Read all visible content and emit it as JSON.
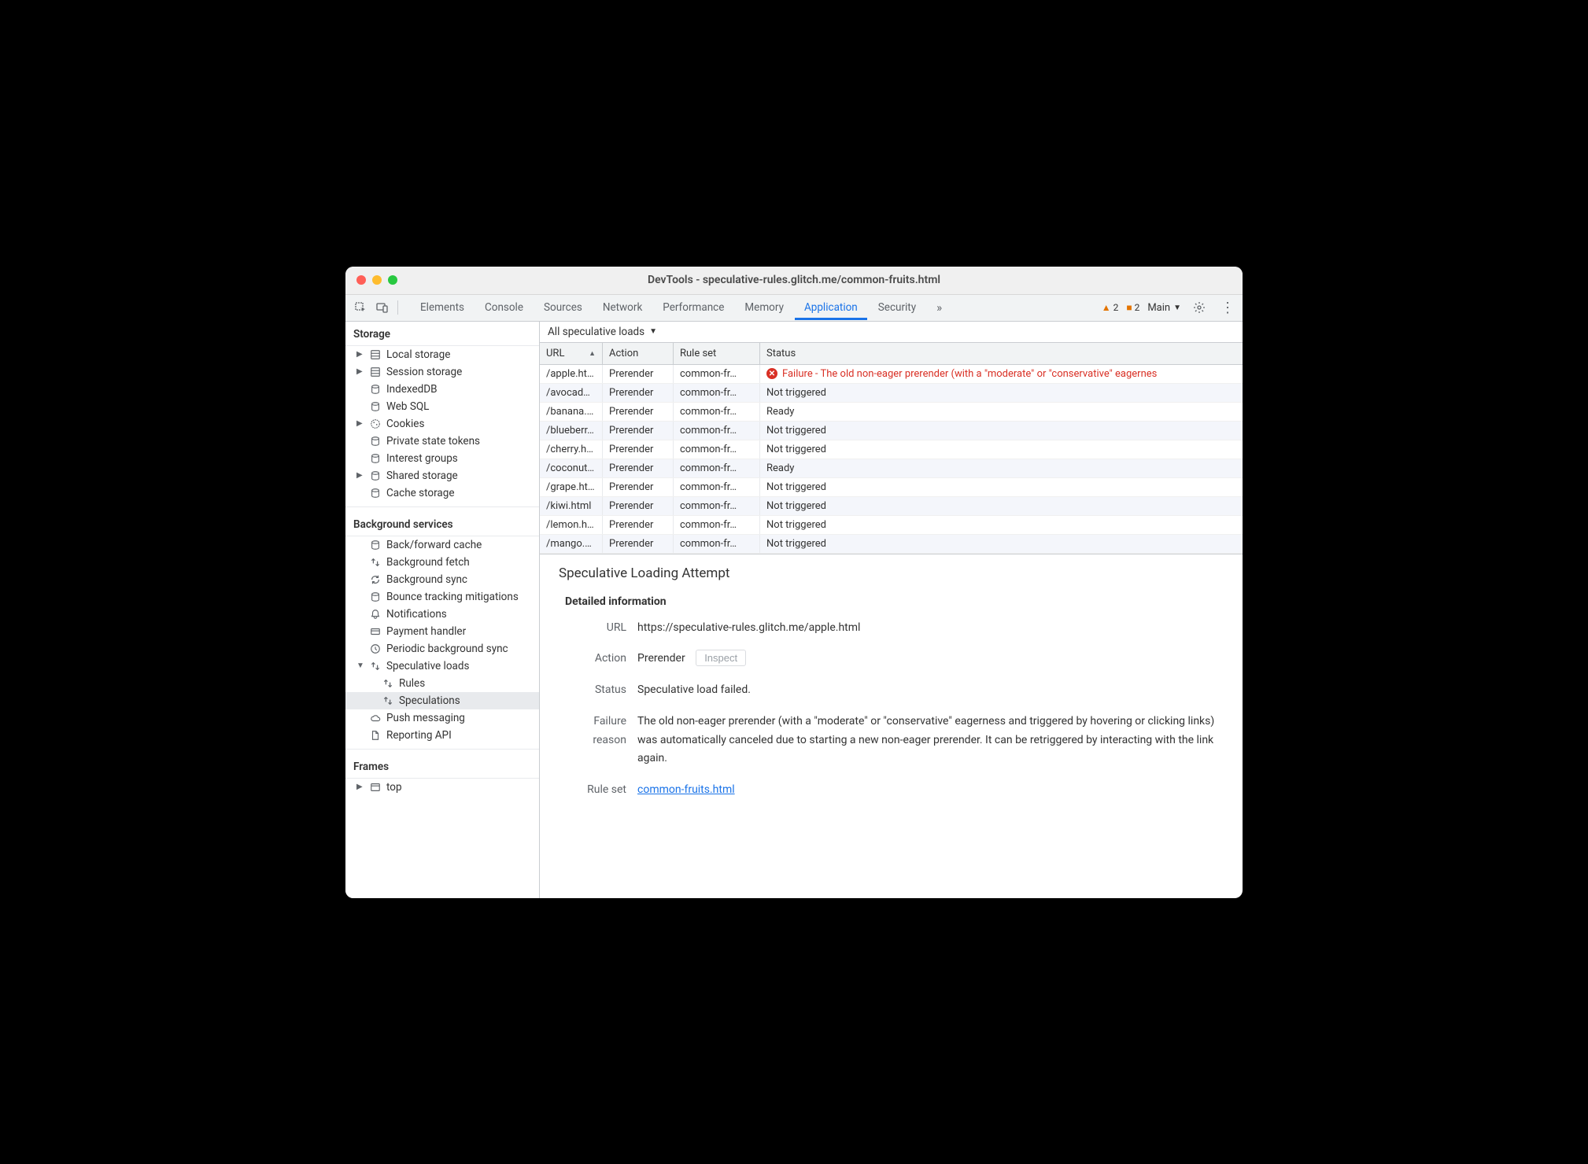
{
  "window": {
    "title": "DevTools - speculative-rules.glitch.me/common-fruits.html"
  },
  "toolbar": {
    "tabs": [
      "Elements",
      "Console",
      "Sources",
      "Network",
      "Performance",
      "Memory",
      "Application",
      "Security"
    ],
    "active_tab": "Application",
    "overflow": "»",
    "warning_count": "2",
    "error_count": "2",
    "main_label": "Main"
  },
  "sidebar": {
    "storage": {
      "title": "Storage",
      "items": [
        {
          "label": "Local storage",
          "icon": "database",
          "expandable": true
        },
        {
          "label": "Session storage",
          "icon": "database",
          "expandable": true
        },
        {
          "label": "IndexedDB",
          "icon": "db-cylinder"
        },
        {
          "label": "Web SQL",
          "icon": "db-cylinder"
        },
        {
          "label": "Cookies",
          "icon": "cookie",
          "expandable": true
        },
        {
          "label": "Private state tokens",
          "icon": "db-cylinder"
        },
        {
          "label": "Interest groups",
          "icon": "db-cylinder"
        },
        {
          "label": "Shared storage",
          "icon": "db-cylinder",
          "expandable": true
        },
        {
          "label": "Cache storage",
          "icon": "db-cylinder"
        }
      ]
    },
    "background": {
      "title": "Background services",
      "items": [
        {
          "label": "Back/forward cache",
          "icon": "db-cylinder"
        },
        {
          "label": "Background fetch",
          "icon": "arrows"
        },
        {
          "label": "Background sync",
          "icon": "sync"
        },
        {
          "label": "Bounce tracking mitigations",
          "icon": "db-cylinder"
        },
        {
          "label": "Notifications",
          "icon": "bell"
        },
        {
          "label": "Payment handler",
          "icon": "card"
        },
        {
          "label": "Periodic background sync",
          "icon": "clock"
        },
        {
          "label": "Speculative loads",
          "icon": "arrows",
          "expandable": true,
          "expanded": true,
          "children": [
            {
              "label": "Rules",
              "icon": "arrows"
            },
            {
              "label": "Speculations",
              "icon": "arrows",
              "selected": true
            }
          ]
        },
        {
          "label": "Push messaging",
          "icon": "cloud"
        },
        {
          "label": "Reporting API",
          "icon": "doc"
        }
      ]
    },
    "frames": {
      "title": "Frames",
      "items": [
        {
          "label": "top",
          "icon": "frame",
          "expandable": true
        }
      ]
    }
  },
  "filter": {
    "label": "All speculative loads"
  },
  "table": {
    "headers": {
      "url": "URL",
      "action": "Action",
      "ruleset": "Rule set",
      "status": "Status"
    },
    "rows": [
      {
        "url": "/apple.html",
        "action": "Prerender",
        "ruleset": "common-fr…",
        "status": "Failure - The old non-eager prerender (with a \"moderate\" or \"conservative\" eagernes",
        "error": true
      },
      {
        "url": "/avocad…",
        "action": "Prerender",
        "ruleset": "common-fr…",
        "status": "Not triggered"
      },
      {
        "url": "/banana.…",
        "action": "Prerender",
        "ruleset": "common-fr…",
        "status": "Ready"
      },
      {
        "url": "/blueberr…",
        "action": "Prerender",
        "ruleset": "common-fr…",
        "status": "Not triggered"
      },
      {
        "url": "/cherry.h…",
        "action": "Prerender",
        "ruleset": "common-fr…",
        "status": "Not triggered"
      },
      {
        "url": "/coconut…",
        "action": "Prerender",
        "ruleset": "common-fr…",
        "status": "Ready"
      },
      {
        "url": "/grape.html",
        "action": "Prerender",
        "ruleset": "common-fr…",
        "status": "Not triggered"
      },
      {
        "url": "/kiwi.html",
        "action": "Prerender",
        "ruleset": "common-fr…",
        "status": "Not triggered"
      },
      {
        "url": "/lemon.h…",
        "action": "Prerender",
        "ruleset": "common-fr…",
        "status": "Not triggered"
      },
      {
        "url": "/mango.…",
        "action": "Prerender",
        "ruleset": "common-fr…",
        "status": "Not triggered"
      }
    ]
  },
  "detail": {
    "heading": "Speculative Loading Attempt",
    "section": "Detailed information",
    "url_label": "URL",
    "url_value": "https://speculative-rules.glitch.me/apple.html",
    "action_label": "Action",
    "action_value": "Prerender",
    "inspect": "Inspect",
    "status_label": "Status",
    "status_value": "Speculative load failed.",
    "failure_label": "Failure reason",
    "failure_value": "The old non-eager prerender (with a \"moderate\" or \"conservative\" eagerness and triggered by hovering or clicking links) was automatically canceled due to starting a new non-eager prerender. It can be retriggered by interacting with the link again.",
    "ruleset_label": "Rule set",
    "ruleset_value": "common-fruits.html"
  }
}
